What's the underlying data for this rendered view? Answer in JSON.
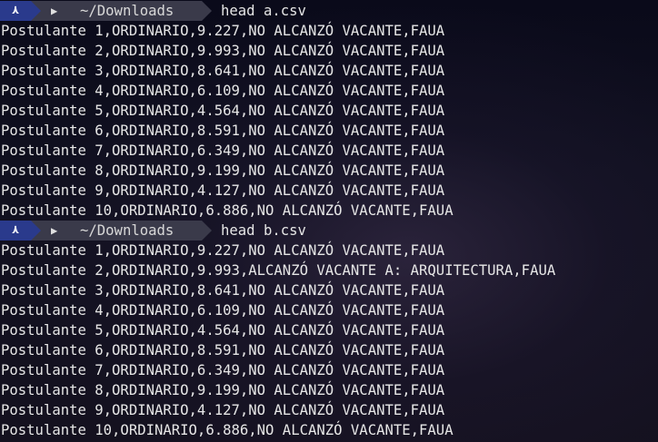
{
  "prompts": [
    {
      "arch_icon": "arch-logo-icon",
      "folder_icon": "folder-icon",
      "directory": "~/Downloads",
      "command": "head a.csv"
    },
    {
      "arch_icon": "arch-logo-icon",
      "folder_icon": "folder-icon",
      "directory": "~/Downloads",
      "command": "head b.csv"
    }
  ],
  "outputs": {
    "a": [
      "Postulante 1,ORDINARIO,9.227,NO ALCANZÓ VACANTE,FAUA",
      "Postulante 2,ORDINARIO,9.993,NO ALCANZÓ VACANTE,FAUA",
      "Postulante 3,ORDINARIO,8.641,NO ALCANZÓ VACANTE,FAUA",
      "Postulante 4,ORDINARIO,6.109,NO ALCANZÓ VACANTE,FAUA",
      "Postulante 5,ORDINARIO,4.564,NO ALCANZÓ VACANTE,FAUA",
      "Postulante 6,ORDINARIO,8.591,NO ALCANZÓ VACANTE,FAUA",
      "Postulante 7,ORDINARIO,6.349,NO ALCANZÓ VACANTE,FAUA",
      "Postulante 8,ORDINARIO,9.199,NO ALCANZÓ VACANTE,FAUA",
      "Postulante 9,ORDINARIO,4.127,NO ALCANZÓ VACANTE,FAUA",
      "Postulante 10,ORDINARIO,6.886,NO ALCANZÓ VACANTE,FAUA"
    ],
    "b": [
      "Postulante 1,ORDINARIO,9.227,NO ALCANZÓ VACANTE,FAUA",
      "Postulante 2,ORDINARIO,9.993,ALCANZÓ VACANTE A: ARQUITECTURA,FAUA",
      "Postulante 3,ORDINARIO,8.641,NO ALCANZÓ VACANTE,FAUA",
      "Postulante 4,ORDINARIO,6.109,NO ALCANZÓ VACANTE,FAUA",
      "Postulante 5,ORDINARIO,4.564,NO ALCANZÓ VACANTE,FAUA",
      "Postulante 6,ORDINARIO,8.591,NO ALCANZÓ VACANTE,FAUA",
      "Postulante 7,ORDINARIO,6.349,NO ALCANZÓ VACANTE,FAUA",
      "Postulante 8,ORDINARIO,9.199,NO ALCANZÓ VACANTE,FAUA",
      "Postulante 9,ORDINARIO,4.127,NO ALCANZÓ VACANTE,FAUA",
      "Postulante 10,ORDINARIO,6.886,NO ALCANZÓ VACANTE,FAUA"
    ]
  },
  "colors": {
    "arch_segment": "#2a3a8c",
    "dir_segment": "#3a3a4a",
    "text": "#e6e6e6",
    "background": "#0c0c1d"
  }
}
